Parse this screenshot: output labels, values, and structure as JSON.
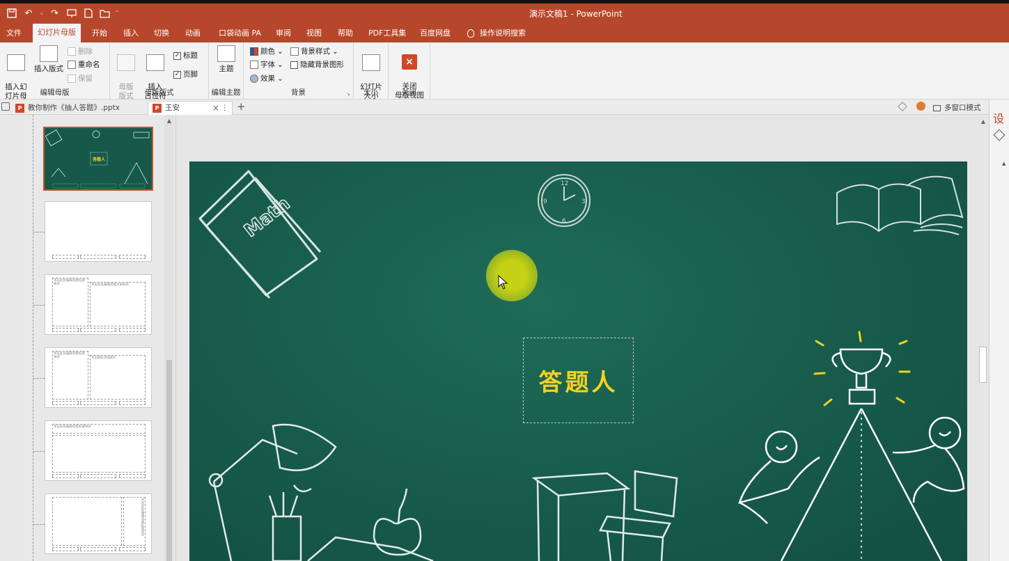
{
  "window": {
    "title": "演示文稿1  -  PowerPoint"
  },
  "quick_access": [
    {
      "name": "save-icon",
      "glyph": "▪"
    },
    {
      "name": "undo-icon",
      "glyph": "↶"
    },
    {
      "name": "redo-icon",
      "glyph": "↷"
    },
    {
      "name": "present-icon",
      "glyph": "⎚"
    },
    {
      "name": "new-file-icon",
      "glyph": "▯"
    },
    {
      "name": "open-folder-icon",
      "glyph": "▰"
    },
    {
      "name": "customize-icon",
      "glyph": "⁼"
    }
  ],
  "tabs": [
    {
      "label": "文件",
      "active": false
    },
    {
      "label": "幻灯片母版",
      "active": true
    },
    {
      "label": "开始",
      "active": false
    },
    {
      "label": "插入",
      "active": false
    },
    {
      "label": "切换",
      "active": false
    },
    {
      "label": "动画",
      "active": false
    },
    {
      "label": "口袋动画 PA",
      "active": false
    },
    {
      "label": "审阅",
      "active": false
    },
    {
      "label": "视图",
      "active": false
    },
    {
      "label": "帮助",
      "active": false
    },
    {
      "label": "PDF工具集",
      "active": false
    },
    {
      "label": "百度网盘",
      "active": false
    },
    {
      "label": "操作说明搜索",
      "active": false
    }
  ],
  "ribbon": {
    "edit_master": {
      "label": "编辑母版",
      "insert_master": "插入幻\n灯片母版",
      "insert_layout": "插入版式",
      "delete": "删除",
      "rename": "重命名",
      "preserve": "保留"
    },
    "master_layout": {
      "label": "母版版式",
      "master_layout_btn": "母版\n版式",
      "insert_placeholder": "插入\n占位符",
      "title_chk": "标题",
      "footer_chk": "页脚",
      "title_checked": true,
      "footer_checked": true
    },
    "edit_theme": {
      "label": "编辑主题",
      "theme": "主题"
    },
    "background": {
      "label": "背景",
      "colors": "颜色",
      "fonts": "字体",
      "effects": "效果",
      "bg_styles": "背景样式",
      "hide_bg": "隐藏背景图形",
      "hide_bg_checked": false
    },
    "size": {
      "label": "大小",
      "slide_size": "幻灯片\n大小"
    },
    "close": {
      "label": "关闭",
      "close_master": "关闭\n母版视图"
    }
  },
  "doc_tabs": [
    {
      "label": "教你制作《抽人答题》.pptx",
      "active": false
    },
    {
      "label": "王安",
      "active": true
    }
  ],
  "doc_tabs_right": {
    "multi_window": "多窗口模式"
  },
  "slide": {
    "title_text": "答题人",
    "book_text": "Math"
  },
  "thumbnails": {
    "t3_left": "单击此处编辑母版标题样式",
    "t3_right": "单击此处编辑母版文本样式",
    "t4_left": "单击此处编辑母版标题样式",
    "t4_right": "单击图标添加图片",
    "t5_title": "单击此处编辑母版标题样式",
    "t6_title": "单击此处编辑母版标题样式"
  },
  "right_pane": {
    "title": "设"
  }
}
